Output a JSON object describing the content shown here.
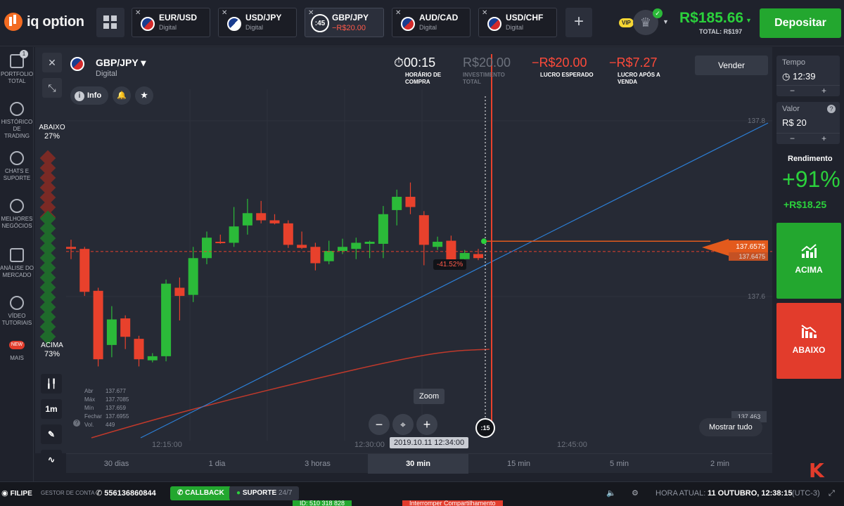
{
  "brand": {
    "name": "iq option"
  },
  "asset_tabs": [
    {
      "name": "EUR/USD",
      "sub": "Digital"
    },
    {
      "name": "USD/JPY",
      "sub": "Digital"
    },
    {
      "name": "GBP/JPY",
      "sub": "−R$20.00",
      "timer": ":45",
      "active": true
    },
    {
      "name": "AUD/CAD",
      "sub": "Digital"
    },
    {
      "name": "USD/CHF",
      "sub": "Digital"
    }
  ],
  "account": {
    "vip": "VIP",
    "balance": "R$185.66",
    "total": "TOTAL: R$197",
    "deposit": "Depositar"
  },
  "sidebar": [
    {
      "label": "PORTFOLIO TOTAL",
      "badge": "1"
    },
    {
      "label": "HISTÓRICO DE TRADING"
    },
    {
      "label": "CHATS E SUPORTE"
    },
    {
      "label": "MELHORES NEGÓCIOS"
    },
    {
      "label": "ANÁLISE DO MERCADO"
    },
    {
      "label": "VÍDEO TUTORIAIS"
    },
    {
      "label": "MAIS",
      "new": "NEW"
    }
  ],
  "pair": {
    "name": "GBP/JPY",
    "type": "Digital",
    "info": "Info"
  },
  "sentiment": {
    "down_label": "ABAIXO",
    "down_pct": "27%",
    "up_label": "ACIMA",
    "up_pct": "73%"
  },
  "stats": {
    "timer": "00:15",
    "timer_label": "HORÁRIO DE COMPRA",
    "invest": "R$20.00",
    "invest_label": "INVESTIMENTO TOTAL",
    "expected": "−R$20.00",
    "expected_label": "LUCRO ESPERADO",
    "after": "−R$7.27",
    "after_label": "LUCRO APÓS A VENDA",
    "sell": "Vender"
  },
  "axis": {
    "y_top": "137.8",
    "y_mid": "137.6",
    "y_low": "137.463",
    "current_price": "137.6575",
    "prev_price": "137.6475",
    "pct": "-41.52%"
  },
  "ohlc": [
    {
      "k": "Abr",
      "v": "137.677"
    },
    {
      "k": "Máx",
      "v": "137.7085"
    },
    {
      "k": "Mín",
      "v": "137.659"
    },
    {
      "k": "Fechar",
      "v": "137.6955"
    },
    {
      "k": "Vol.",
      "v": "449"
    }
  ],
  "tools": {
    "interval": "1m",
    "badge": "1"
  },
  "zoom": {
    "tip": "Zoom",
    "timer": ":15"
  },
  "time_axis": {
    "t1": "12:15:00",
    "t2": "12:30:00",
    "cursor": "2019.10.11 12:34:00",
    "t3": "12:45:00"
  },
  "show_all": "Mostrar tudo",
  "timeframes": [
    "30 dias",
    "1 dia",
    "3 horas",
    "30 min",
    "15 min",
    "5 min",
    "2 min"
  ],
  "right": {
    "tempo_label": "Tempo",
    "tempo_value": "12:39",
    "valor_label": "Valor",
    "valor_value": "R$ 20",
    "rend_label": "Rendimento",
    "rend_pct": "+91%",
    "rend_amt": "+R$18.25",
    "up": "ACIMA",
    "down": "ABAIXO"
  },
  "bottom": {
    "user": "FILIPE",
    "manager": "GESTOR DE CONTA",
    "phone": "556136860844",
    "callback": "CALLBACK",
    "support": "SUPORTE",
    "support_hours": "24/7",
    "time_label": "HORA ATUAL:",
    "time_value": "11 OUTUBRO, 12:38:15",
    "tz": "(UTC-3)",
    "strip1": "ID: 510 318 828",
    "strip2": "Interromper Compartilhamento"
  },
  "colors": {
    "up": "#2bba39",
    "down": "#e8412c",
    "accent": "#f26b21"
  },
  "chart_data": {
    "type": "candlestick",
    "candles": [
      {
        "o": 137.652,
        "c": 137.65,
        "h": 137.659,
        "l": 137.64
      },
      {
        "o": 137.65,
        "c": 137.608,
        "h": 137.652,
        "l": 137.604
      },
      {
        "o": 137.609,
        "c": 137.542,
        "h": 137.612,
        "l": 137.535
      },
      {
        "o": 137.556,
        "c": 137.581,
        "h": 137.594,
        "l": 137.544
      },
      {
        "o": 137.582,
        "c": 137.564,
        "h": 137.585,
        "l": 137.552
      },
      {
        "o": 137.562,
        "c": 137.542,
        "h": 137.565,
        "l": 137.535
      },
      {
        "o": 137.541,
        "c": 137.545,
        "h": 137.548,
        "l": 137.539
      },
      {
        "o": 137.545,
        "c": 137.616,
        "h": 137.62,
        "l": 137.54
      },
      {
        "o": 137.612,
        "c": 137.604,
        "h": 137.622,
        "l": 137.58
      },
      {
        "o": 137.605,
        "c": 137.641,
        "h": 137.652,
        "l": 137.598
      },
      {
        "o": 137.641,
        "c": 137.661,
        "h": 137.667,
        "l": 137.635
      },
      {
        "o": 137.657,
        "c": 137.656,
        "h": 137.664,
        "l": 137.655
      },
      {
        "o": 137.656,
        "c": 137.672,
        "h": 137.691,
        "l": 137.652
      },
      {
        "o": 137.673,
        "c": 137.685,
        "h": 137.699,
        "l": 137.664
      },
      {
        "o": 137.685,
        "c": 137.678,
        "h": 137.697,
        "l": 137.675
      },
      {
        "o": 137.678,
        "c": 137.675,
        "h": 137.684,
        "l": 137.674
      },
      {
        "o": 137.675,
        "c": 137.654,
        "h": 137.678,
        "l": 137.651
      },
      {
        "o": 137.654,
        "c": 137.651,
        "h": 137.667,
        "l": 137.65
      },
      {
        "o": 137.652,
        "c": 137.636,
        "h": 137.656,
        "l": 137.629
      },
      {
        "o": 137.638,
        "c": 137.648,
        "h": 137.658,
        "l": 137.635
      },
      {
        "o": 137.648,
        "c": 137.652,
        "h": 137.66,
        "l": 137.645
      },
      {
        "o": 137.65,
        "c": 137.656,
        "h": 137.661,
        "l": 137.64
      },
      {
        "o": 137.655,
        "c": 137.657,
        "h": 137.658,
        "l": 137.641
      },
      {
        "o": 137.655,
        "c": 137.684,
        "h": 137.692,
        "l": 137.641
      },
      {
        "o": 137.688,
        "c": 137.701,
        "h": 137.708,
        "l": 137.673
      },
      {
        "o": 137.701,
        "c": 137.691,
        "h": 137.715,
        "l": 137.684
      },
      {
        "o": 137.683,
        "c": 137.654,
        "h": 137.687,
        "l": 137.634
      },
      {
        "o": 137.652,
        "c": 137.657,
        "h": 137.662,
        "l": 137.649
      },
      {
        "o": 137.658,
        "c": 137.638,
        "h": 137.663,
        "l": 137.636
      },
      {
        "o": 137.64,
        "c": 137.646,
        "h": 137.649,
        "l": 137.638
      },
      {
        "o": 137.645,
        "c": 137.641,
        "h": 137.65,
        "l": 137.639
      }
    ],
    "ylim": [
      137.45,
      137.82
    ],
    "y_ticks": [
      "137.8",
      "137.6"
    ],
    "x_ticks": [
      "12:15:00",
      "12:30:00",
      "12:45:00"
    ],
    "price_line": 137.6475,
    "current_price": 137.6575
  }
}
